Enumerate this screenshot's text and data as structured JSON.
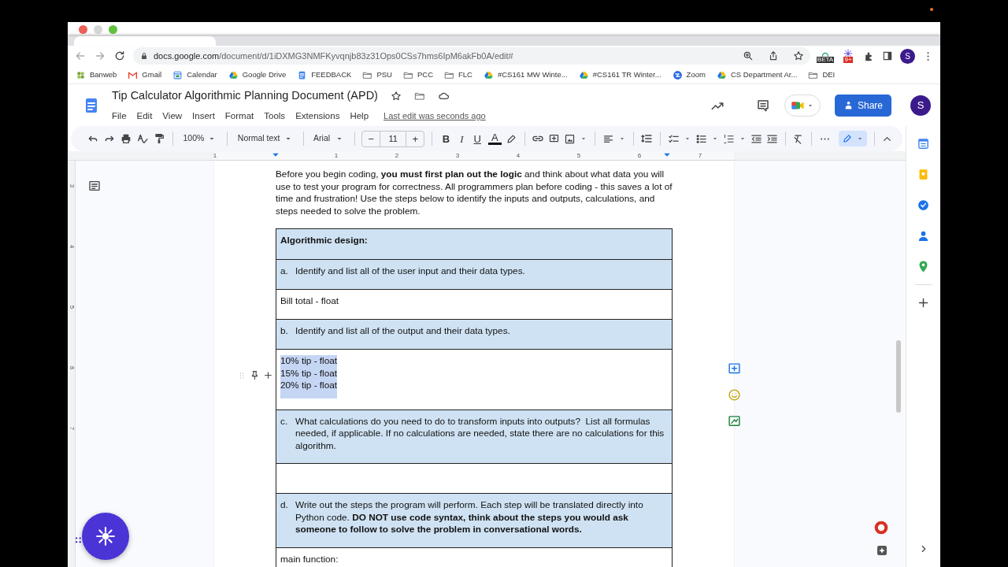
{
  "browser": {
    "url_host": "docs.google.com",
    "url_path": "/document/d/1iDXMG3NMFKyvqnjb83z31Ops0CSs7hms6IpM6akFb0A/edit#",
    "extension_badges": [
      "BETA",
      "9+"
    ],
    "profile_initial": "S"
  },
  "bookmarks": [
    {
      "label": "Banweb",
      "kind": "web"
    },
    {
      "label": "Gmail",
      "kind": "mail"
    },
    {
      "label": "Calendar",
      "kind": "calendar"
    },
    {
      "label": "Google Drive",
      "kind": "drive"
    },
    {
      "label": "FEEDBACK",
      "kind": "doc"
    },
    {
      "label": "PSU",
      "kind": "folder"
    },
    {
      "label": "PCC",
      "kind": "folder"
    },
    {
      "label": "FLC",
      "kind": "folder"
    },
    {
      "label": "#CS161 MW Winte...",
      "kind": "drive"
    },
    {
      "label": "#CS161 TR Winter...",
      "kind": "drive"
    },
    {
      "label": "Zoom",
      "kind": "zoom"
    },
    {
      "label": "CS Department Ar...",
      "kind": "drive"
    },
    {
      "label": "DEI",
      "kind": "folder"
    }
  ],
  "document": {
    "title": "Tip Calculator Algorithmic Planning Document (APD)",
    "menus": [
      "File",
      "Edit",
      "View",
      "Insert",
      "Format",
      "Tools",
      "Extensions",
      "Help"
    ],
    "last_edit": "Last edit was seconds ago",
    "share_label": "Share",
    "avatar_initial": "S"
  },
  "toolbar": {
    "zoom": "100%",
    "style": "Normal text",
    "font": "Arial",
    "size_minus": "−",
    "size": "11",
    "size_plus": "+",
    "format_buttons": [
      "B",
      "I",
      "U",
      "A"
    ]
  },
  "ruler": {
    "horizontal": [
      "1",
      "1",
      "2",
      "3",
      "4",
      "5",
      "6",
      "7"
    ],
    "vertical": [
      "3",
      "4",
      "5",
      "6",
      "7"
    ]
  },
  "intro": "Before you begin coding, **you must first plan out the logic** and think about what data you will use to test your program for correctness. All programmers plan before coding - this saves a lot of time and frustration! Use the steps below to identify the inputs and outputs, calculations, and steps needed to solve the problem.",
  "table": {
    "rows": [
      {
        "kind": "heading",
        "text": "Algorithmic design:"
      },
      {
        "kind": "step",
        "marker": "a.",
        "text": "Identify and list all of the user input and their data types."
      },
      {
        "kind": "answer",
        "lines": [
          "Bill total - float"
        ],
        "selected": false
      },
      {
        "kind": "step",
        "marker": "b.",
        "text": "Identify and list all of the output and their data types."
      },
      {
        "kind": "answer",
        "lines": [
          "10% tip - float",
          "15% tip - float",
          "20% tip - float"
        ],
        "selected": true
      },
      {
        "kind": "step",
        "marker": "c.",
        "text": "What calculations do you need to do to transform inputs into outputs?  List all formulas needed, if applicable. If no calculations are needed, state there are no calculations for this algorithm."
      },
      {
        "kind": "answer",
        "selected": false
      },
      {
        "kind": "step",
        "marker": "d.",
        "text": "Write out the steps the program will perform. Each step will be translated directly into Python code. **DO NOT use code syntax, think about the steps you would ask someone to follow to solve the problem in conversational words.**"
      },
      {
        "kind": "answer",
        "lines": [
          "main function:"
        ],
        "selected": false
      }
    ]
  }
}
